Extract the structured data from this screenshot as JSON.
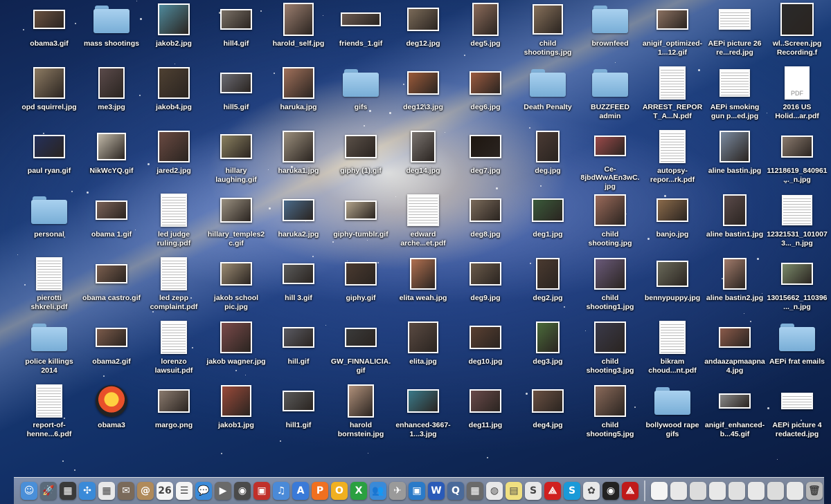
{
  "desktop": {
    "icons": [
      {
        "name": "obama3.gif",
        "kind": "image",
        "color": "#6a5140",
        "w": 46,
        "h": 28,
        "col": 0,
        "row": 0
      },
      {
        "name": "mass shootings",
        "kind": "folder",
        "col": 1,
        "row": 0
      },
      {
        "name": "jakob2.jpg",
        "kind": "image",
        "color": "#4f8a9c",
        "w": 46,
        "h": 46,
        "col": 2,
        "row": 0
      },
      {
        "name": "hill4.gif",
        "kind": "image",
        "color": "#7a7066",
        "w": 46,
        "h": 30,
        "col": 3,
        "row": 0
      },
      {
        "name": "harold_self.jpg",
        "kind": "image",
        "color": "#9a7d6e",
        "w": 44,
        "h": 48,
        "col": 4,
        "row": 0
      },
      {
        "name": "friends_1.gif",
        "kind": "image",
        "color": "#6b5a52",
        "w": 58,
        "h": 20,
        "col": 5,
        "row": 0
      },
      {
        "name": "deg12.jpg",
        "kind": "image",
        "color": "#7a6a58",
        "w": 46,
        "h": 34,
        "col": 6,
        "row": 0
      },
      {
        "name": "deg5.jpg",
        "kind": "image",
        "color": "#8b6b5a",
        "w": 38,
        "h": 48,
        "col": 7,
        "row": 0
      },
      {
        "name": "child shootings.jpg",
        "kind": "image",
        "color": "#86705a",
        "w": 44,
        "h": 44,
        "col": 8,
        "row": 0
      },
      {
        "name": "brownfeed",
        "kind": "folder",
        "col": 9,
        "row": 0
      },
      {
        "name": "anigif_optimized-1...12.gif",
        "kind": "image",
        "color": "#8a7060",
        "w": 46,
        "h": 30,
        "col": 10,
        "row": 0
      },
      {
        "name": "AEPi picture 26 re...red.jpg",
        "kind": "pdf",
        "w": 46,
        "h": 30,
        "col": 11,
        "row": 0
      },
      {
        "name": "wl..Screen.jpg Recording.f",
        "kind": "image",
        "color": "#2a2a2a",
        "w": 48,
        "h": 48,
        "col": 12,
        "row": 0
      },
      {
        "name": "opd squirrel.jpg",
        "kind": "image",
        "color": "#8c7a62",
        "w": 46,
        "h": 46,
        "col": 0,
        "row": 1
      },
      {
        "name": "me3.jpg",
        "kind": "image",
        "color": "#5a4a4a",
        "w": 38,
        "h": 46,
        "col": 1,
        "row": 1
      },
      {
        "name": "jakob4.jpg",
        "kind": "image",
        "color": "#4e4032",
        "w": 46,
        "h": 46,
        "col": 2,
        "row": 1
      },
      {
        "name": "hill5.gif",
        "kind": "image",
        "color": "#6a6a72",
        "w": 46,
        "h": 30,
        "col": 3,
        "row": 1
      },
      {
        "name": "haruka.jpg",
        "kind": "image",
        "color": "#a0705a",
        "w": 46,
        "h": 46,
        "col": 4,
        "row": 1
      },
      {
        "name": "gifs",
        "kind": "folder",
        "col": 5,
        "row": 1
      },
      {
        "name": "deg12\\3.jpg",
        "kind": "image",
        "color": "#9a5a3a",
        "w": 46,
        "h": 34,
        "col": 6,
        "row": 1
      },
      {
        "name": "deg6.jpg",
        "kind": "image",
        "color": "#9a5a40",
        "w": 46,
        "h": 34,
        "col": 7,
        "row": 1
      },
      {
        "name": "Death Penalty",
        "kind": "folder",
        "col": 8,
        "row": 1
      },
      {
        "name": "BUZZFEED admin",
        "kind": "folder",
        "col": 9,
        "row": 1
      },
      {
        "name": "ARREST_REPORT_A...N.pdf",
        "kind": "pdf",
        "w": 38,
        "h": 48,
        "col": 10,
        "row": 1
      },
      {
        "name": "AEPi smoking gun p...ed.jpg",
        "kind": "pdf",
        "w": 44,
        "h": 40,
        "col": 11,
        "row": 1
      },
      {
        "name": "2016 US Holid...ar.pdf",
        "kind": "pdfgen",
        "w": 36,
        "h": 48,
        "col": 12,
        "row": 1
      },
      {
        "name": "paul ryan.gif",
        "kind": "image",
        "color": "#24305a",
        "w": 46,
        "h": 34,
        "col": 0,
        "row": 2
      },
      {
        "name": "NikWcYQ.gif",
        "kind": "image",
        "color": "#c0b8a8",
        "w": 42,
        "h": 40,
        "col": 1,
        "row": 2
      },
      {
        "name": "jared2.jpg",
        "kind": "image",
        "color": "#6a4a42",
        "w": 46,
        "h": 46,
        "col": 2,
        "row": 2
      },
      {
        "name": "hillary laughing.gif",
        "kind": "image",
        "color": "#8a8060",
        "w": 46,
        "h": 36,
        "col": 3,
        "row": 2
      },
      {
        "name": "haruka1.jpg",
        "kind": "image",
        "color": "#9a8e7c",
        "w": 46,
        "h": 46,
        "col": 4,
        "row": 2
      },
      {
        "name": "giphy (1).gif",
        "kind": "image",
        "color": "#5a5048",
        "w": 46,
        "h": 34,
        "col": 5,
        "row": 2
      },
      {
        "name": "deg14.jpg",
        "kind": "image",
        "color": "#7a7470",
        "w": 36,
        "h": 46,
        "col": 6,
        "row": 2
      },
      {
        "name": "deg7.jpg",
        "kind": "image",
        "color": "#1e1610",
        "w": 46,
        "h": 34,
        "col": 7,
        "row": 2
      },
      {
        "name": "deg.jpg",
        "kind": "image",
        "color": "#4a3a34",
        "w": 34,
        "h": 46,
        "col": 8,
        "row": 2
      },
      {
        "name": "Ce-8jbdWwAEn3wC.jpg",
        "kind": "image",
        "color": "#9a4a4a",
        "w": 46,
        "h": 30,
        "col": 9,
        "row": 2
      },
      {
        "name": "autopsy-repor...rk.pdf",
        "kind": "pdf",
        "w": 38,
        "h": 48,
        "col": 10,
        "row": 2
      },
      {
        "name": "aline bastin.jpg",
        "kind": "image",
        "color": "#7a8aa0",
        "w": 44,
        "h": 46,
        "col": 11,
        "row": 2
      },
      {
        "name": "11218619_840961..._n.jpg",
        "kind": "image",
        "color": "#8a7a6e",
        "w": 46,
        "h": 32,
        "col": 12,
        "row": 2
      },
      {
        "name": "personal",
        "kind": "folder",
        "col": 0,
        "row": 3
      },
      {
        "name": "obama 1.gif",
        "kind": "image",
        "color": "#7a6258",
        "w": 46,
        "h": 28,
        "col": 1,
        "row": 3
      },
      {
        "name": "led judge ruling.pdf",
        "kind": "pdf",
        "w": 38,
        "h": 48,
        "col": 2,
        "row": 3
      },
      {
        "name": "hillary_temples2c.gif",
        "kind": "image",
        "color": "#9a9080",
        "w": 46,
        "h": 36,
        "col": 3,
        "row": 3
      },
      {
        "name": "haruka2.jpg",
        "kind": "image",
        "color": "#4a6a8a",
        "w": 46,
        "h": 32,
        "col": 4,
        "row": 3
      },
      {
        "name": "giphy-tumblr.gif",
        "kind": "image",
        "color": "#b0a28a",
        "w": 46,
        "h": 28,
        "col": 5,
        "row": 3
      },
      {
        "name": "edward arche...et.pdf",
        "kind": "pdf",
        "w": 46,
        "h": 46,
        "col": 6,
        "row": 3
      },
      {
        "name": "deg8.jpg",
        "kind": "image",
        "color": "#7a6a5a",
        "w": 46,
        "h": 34,
        "col": 7,
        "row": 3
      },
      {
        "name": "deg1.jpg",
        "kind": "image",
        "color": "#3a5a3a",
        "w": 46,
        "h": 34,
        "col": 8,
        "row": 3
      },
      {
        "name": "child shooting.jpg",
        "kind": "image",
        "color": "#9a6a5a",
        "w": 46,
        "h": 46,
        "col": 9,
        "row": 3
      },
      {
        "name": "banjo.jpg",
        "kind": "image",
        "color": "#8a6a4a",
        "w": 46,
        "h": 34,
        "col": 10,
        "row": 3
      },
      {
        "name": "aline bastin1.jpg",
        "kind": "image",
        "color": "#5a4a4a",
        "w": 34,
        "h": 46,
        "col": 11,
        "row": 3
      },
      {
        "name": "12321531_1010073..._n.jpg",
        "kind": "pdf",
        "w": 44,
        "h": 44,
        "col": 12,
        "row": 3
      },
      {
        "name": "pierotti shkreli.pdf",
        "kind": "pdf",
        "w": 38,
        "h": 48,
        "col": 0,
        "row": 4
      },
      {
        "name": "obama castro.gif",
        "kind": "image",
        "color": "#7a5e4e",
        "w": 46,
        "h": 28,
        "col": 1,
        "row": 4
      },
      {
        "name": "led zepp complaint.pdf",
        "kind": "pdf",
        "w": 38,
        "h": 48,
        "col": 2,
        "row": 4
      },
      {
        "name": "jakob school pic.jpg",
        "kind": "image",
        "color": "#9a8a72",
        "w": 46,
        "h": 34,
        "col": 3,
        "row": 4
      },
      {
        "name": "hill 3.gif",
        "kind": "image",
        "color": "#5a5a5a",
        "w": 46,
        "h": 30,
        "col": 4,
        "row": 4
      },
      {
        "name": "giphy.gif",
        "kind": "image",
        "color": "#4a3a30",
        "w": 46,
        "h": 34,
        "col": 5,
        "row": 4
      },
      {
        "name": "elita weah.jpg",
        "kind": "image",
        "color": "#b07050",
        "w": 38,
        "h": 46,
        "col": 6,
        "row": 4
      },
      {
        "name": "deg9.jpg",
        "kind": "image",
        "color": "#6a5a4a",
        "w": 46,
        "h": 34,
        "col": 7,
        "row": 4
      },
      {
        "name": "deg2.jpg",
        "kind": "image",
        "color": "#4a3a30",
        "w": 34,
        "h": 46,
        "col": 8,
        "row": 4
      },
      {
        "name": "child shooting1.jpg",
        "kind": "image",
        "color": "#6a5a7a",
        "w": 46,
        "h": 46,
        "col": 9,
        "row": 4
      },
      {
        "name": "bennypuppy.jpg",
        "kind": "image",
        "color": "#6a6a5a",
        "w": 46,
        "h": 38,
        "col": 10,
        "row": 4
      },
      {
        "name": "aline bastin2.jpg",
        "kind": "image",
        "color": "#a07a6a",
        "w": 34,
        "h": 46,
        "col": 11,
        "row": 4
      },
      {
        "name": "13015662_110396..._n.jpg",
        "kind": "image",
        "color": "#7a8a6a",
        "w": 46,
        "h": 32,
        "col": 12,
        "row": 4
      },
      {
        "name": "police killings 2014",
        "kind": "folder",
        "col": 0,
        "row": 5
      },
      {
        "name": "obama2.gif",
        "kind": "image",
        "color": "#7a5a4a",
        "w": 46,
        "h": 28,
        "col": 1,
        "row": 5
      },
      {
        "name": "lorenzo lawsuit.pdf",
        "kind": "pdf",
        "w": 38,
        "h": 48,
        "col": 2,
        "row": 5
      },
      {
        "name": "jakob wagner.jpg",
        "kind": "image",
        "color": "#7a4a4a",
        "w": 46,
        "h": 46,
        "col": 3,
        "row": 5
      },
      {
        "name": "hill.gif",
        "kind": "image",
        "color": "#5a5a62",
        "w": 46,
        "h": 30,
        "col": 4,
        "row": 5
      },
      {
        "name": "GW_FINNALICIA.gif",
        "kind": "image",
        "color": "#3a3a3a",
        "w": 46,
        "h": 28,
        "col": 5,
        "row": 5
      },
      {
        "name": "elita.jpg",
        "kind": "image",
        "color": "#5a4a42",
        "w": 44,
        "h": 46,
        "col": 6,
        "row": 5
      },
      {
        "name": "deg10.jpg",
        "kind": "image",
        "color": "#5a4032",
        "w": 46,
        "h": 34,
        "col": 7,
        "row": 5
      },
      {
        "name": "deg3.jpg",
        "kind": "image",
        "color": "#4a6a3a",
        "w": 34,
        "h": 46,
        "col": 8,
        "row": 5
      },
      {
        "name": "child shooting3.jpg",
        "kind": "image",
        "color": "#3a3a4a",
        "w": 46,
        "h": 46,
        "col": 9,
        "row": 5
      },
      {
        "name": "bikram choud...nt.pdf",
        "kind": "pdf",
        "w": 38,
        "h": 48,
        "col": 10,
        "row": 5
      },
      {
        "name": "andaazapmaapna4.jpg",
        "kind": "image",
        "color": "#8a5a4a",
        "w": 46,
        "h": 30,
        "col": 11,
        "row": 5
      },
      {
        "name": "AEPi frat emails",
        "kind": "folder",
        "col": 12,
        "row": 5
      },
      {
        "name": "report-of-henne...6.pdf",
        "kind": "pdf",
        "w": 38,
        "h": 48,
        "col": 0,
        "row": 6
      },
      {
        "name": "obama3",
        "kind": "app",
        "col": 1,
        "row": 6
      },
      {
        "name": "margo.png",
        "kind": "image",
        "color": "#8a7a6e",
        "w": 46,
        "h": 34,
        "col": 2,
        "row": 6
      },
      {
        "name": "jakob1.jpg",
        "kind": "image",
        "color": "#9a4a3a",
        "w": 44,
        "h": 46,
        "col": 3,
        "row": 6
      },
      {
        "name": "hill1.gif",
        "kind": "image",
        "color": "#5a5a5a",
        "w": 46,
        "h": 30,
        "col": 4,
        "row": 6
      },
      {
        "name": "harold bornstein.jpg",
        "kind": "image",
        "color": "#b0907a",
        "w": 38,
        "h": 48,
        "col": 5,
        "row": 6
      },
      {
        "name": "enhanced-3667-1...3.jpg",
        "kind": "image",
        "color": "#3a7a8a",
        "w": 46,
        "h": 34,
        "col": 6,
        "row": 6
      },
      {
        "name": "deg11.jpg",
        "kind": "image",
        "color": "#6a4a4a",
        "w": 46,
        "h": 34,
        "col": 7,
        "row": 6
      },
      {
        "name": "deg4.jpg",
        "kind": "image",
        "color": "#6a5042",
        "w": 46,
        "h": 34,
        "col": 8,
        "row": 6
      },
      {
        "name": "child shooting5.jpg",
        "kind": "image",
        "color": "#8a6a5a",
        "w": 46,
        "h": 46,
        "col": 9,
        "row": 6
      },
      {
        "name": "bollywood rape gifs",
        "kind": "folder",
        "col": 10,
        "row": 6
      },
      {
        "name": "anigif_enhanced-b...45.gif",
        "kind": "image",
        "color": "#8a8a8a",
        "w": 46,
        "h": 22,
        "col": 11,
        "row": 6
      },
      {
        "name": "AEPi picture 4 redacted.jpg",
        "kind": "pdf",
        "w": 46,
        "h": 24,
        "col": 12,
        "row": 6
      }
    ]
  },
  "dock": {
    "apps": [
      {
        "name": "finder-icon",
        "color": "#4a8fd8",
        "glyph": "☺"
      },
      {
        "name": "launchpad-icon",
        "color": "#5a6a7a",
        "glyph": "🚀"
      },
      {
        "name": "mission-control-icon",
        "color": "#3a3a3a",
        "glyph": "▦"
      },
      {
        "name": "safari-icon",
        "color": "#3a8ad8",
        "glyph": "✣"
      },
      {
        "name": "dashboard-icon",
        "color": "#e8e8e8",
        "glyph": "▦"
      },
      {
        "name": "mail-icon",
        "color": "#7a6a5a",
        "glyph": "✉"
      },
      {
        "name": "contacts-icon",
        "color": "#b08a5a",
        "glyph": "@"
      },
      {
        "name": "calendar-icon",
        "color": "#f4f4f4",
        "glyph": "26"
      },
      {
        "name": "reminders-icon",
        "color": "#f4f4f4",
        "glyph": "☰"
      },
      {
        "name": "messages-icon",
        "color": "#3a8ad8",
        "glyph": "💬"
      },
      {
        "name": "facetime-icon",
        "color": "#6a6a6a",
        "glyph": "▶"
      },
      {
        "name": "photo-booth-icon",
        "color": "#4a4a4a",
        "glyph": "◉"
      },
      {
        "name": "photos-icon",
        "color": "#c0302a",
        "glyph": "▣"
      },
      {
        "name": "itunes-icon",
        "color": "#4a8ad8",
        "glyph": "♫"
      },
      {
        "name": "app-store-icon",
        "color": "#3a7ad8",
        "glyph": "A"
      },
      {
        "name": "pinterest-icon",
        "color": "#f07020",
        "glyph": "P"
      },
      {
        "name": "outlook-icon",
        "color": "#f0b020",
        "glyph": "O"
      },
      {
        "name": "excel-icon",
        "color": "#2aa040",
        "glyph": "X"
      },
      {
        "name": "people-icon",
        "color": "#3a8ad8",
        "glyph": "👥"
      },
      {
        "name": "satellite-icon",
        "color": "#9a9a9a",
        "glyph": "✈"
      },
      {
        "name": "monitor-icon",
        "color": "#2a7ac8",
        "glyph": "▣"
      },
      {
        "name": "word-icon",
        "color": "#2a5ab8",
        "glyph": "W"
      },
      {
        "name": "quicktime-icon",
        "color": "#4a6a9a",
        "glyph": "Q"
      },
      {
        "name": "terminal-icon",
        "color": "#6a6a6a",
        "glyph": "▦"
      },
      {
        "name": "chrome-icon",
        "color": "#e8e8e8",
        "glyph": "◍"
      },
      {
        "name": "stickies-icon",
        "color": "#f0e080",
        "glyph": "▤"
      },
      {
        "name": "slides-icon",
        "color": "#e8e8e8",
        "glyph": "S"
      },
      {
        "name": "acrobat-icon",
        "color": "#d02020",
        "glyph": "⟁"
      },
      {
        "name": "skype-icon",
        "color": "#1a9ad8",
        "glyph": "S"
      },
      {
        "name": "photos-pinwheel-icon",
        "color": "#e8e8e8",
        "glyph": "✿"
      },
      {
        "name": "obama3-app-icon",
        "color": "#222",
        "glyph": "◉"
      },
      {
        "name": "acrobat-reader-icon",
        "color": "#c01a1a",
        "glyph": "⟁"
      }
    ],
    "docs": [
      {
        "name": "document-stack-icon",
        "color": "#f4f4f4",
        "glyph": ""
      },
      {
        "name": "window-minimized-1-icon",
        "color": "#e8e8e8",
        "glyph": ""
      },
      {
        "name": "window-minimized-2-icon",
        "color": "#dcdcdc",
        "glyph": ""
      },
      {
        "name": "window-minimized-3-icon",
        "color": "#e8e8e8",
        "glyph": ""
      },
      {
        "name": "window-minimized-4-icon",
        "color": "#e0e0e0",
        "glyph": ""
      },
      {
        "name": "window-minimized-5-icon",
        "color": "#e8e8e8",
        "glyph": ""
      },
      {
        "name": "window-minimized-6-icon",
        "color": "#dcdcdc",
        "glyph": ""
      },
      {
        "name": "window-minimized-7-icon",
        "color": "#e8e8e8",
        "glyph": ""
      },
      {
        "name": "trash-icon",
        "color": "#b8b8b8",
        "glyph": "🗑"
      }
    ]
  }
}
